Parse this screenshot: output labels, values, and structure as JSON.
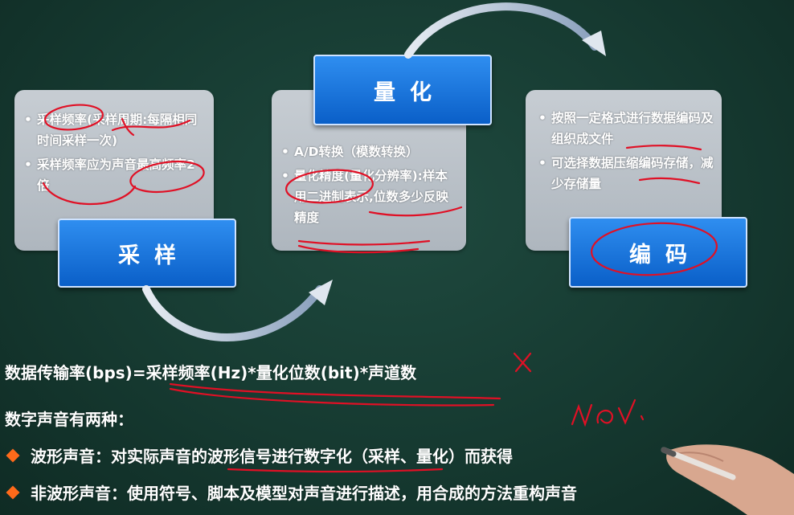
{
  "sampling": {
    "label": "采样",
    "bullets": [
      "采样频率(采样周期:每隔相同时间采样一次)",
      "采样频率应为声音最高频率2倍"
    ]
  },
  "quantization": {
    "label": "量化",
    "bullets": [
      "A/D转换（模数转换）",
      "量化精度(量化分辨率):样本用二进制表示,位数多少反映精度"
    ]
  },
  "encoding": {
    "label": "编码",
    "bullets": [
      "按照一定格式进行数据编码及组织成文件",
      "可选择数据压缩编码存储，减少存储量"
    ]
  },
  "formula": "数据传输率(bps)=采样频率(Hz)*量化位数(bit)*声道数",
  "types_heading": "数字声音有两种：",
  "types": [
    "波形声音：对实际声音的波形信号进行数字化（采样、量化）而获得",
    "非波形声音：使用符号、脚本及模型对声音进行描述，用合成的方法重构声音"
  ],
  "annotations": {
    "x_mark": "x",
    "handwriting": "WAV."
  },
  "colors": {
    "background": "#163a31",
    "box_blue": "#1a74e0",
    "card_gray": "#b8c0c8",
    "annotation_red": "#e01025",
    "bullet_orange": "#ff6a1a"
  }
}
